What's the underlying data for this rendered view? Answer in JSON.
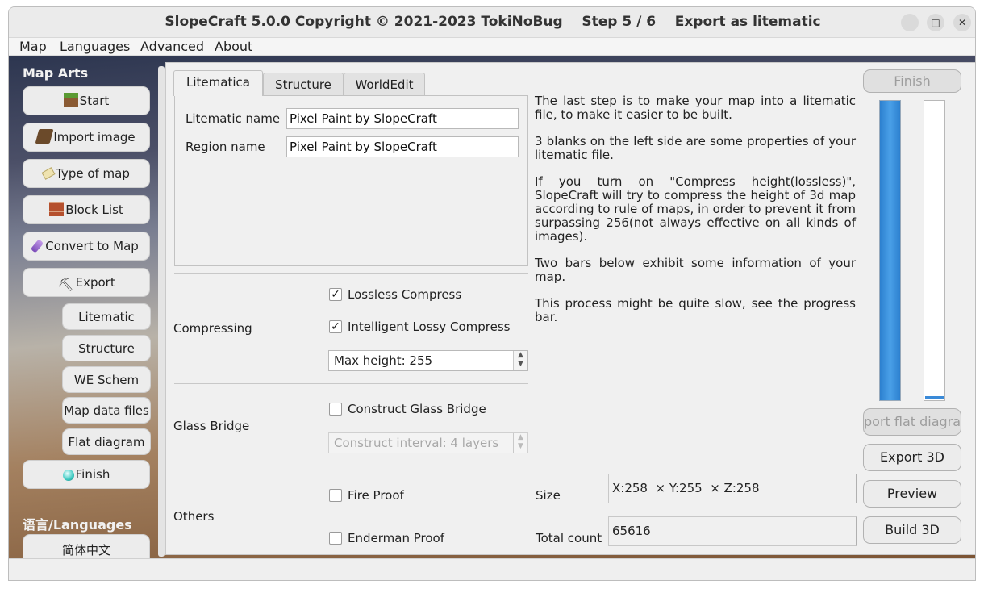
{
  "window": {
    "title": "SlopeCraft 5.0.0 Copyright © 2021-2023 TokiNoBug    Step 5 / 6    Export as litematic",
    "minimize": "–",
    "maximize": "□",
    "close": "✕"
  },
  "menubar": [
    "Map",
    "Languages",
    "Advanced",
    "About"
  ],
  "sidebar": {
    "title": "Map Arts",
    "items": [
      {
        "label": "Start",
        "icon": "grass-block-icon"
      },
      {
        "label": "Import image",
        "icon": "book-icon"
      },
      {
        "label": "Type of map",
        "icon": "map-paper-icon"
      },
      {
        "label": "Block List",
        "icon": "brick-icon"
      },
      {
        "label": "Convert to Map",
        "icon": "crystal-icon"
      },
      {
        "label": "Export",
        "icon": "pickaxe-icon"
      }
    ],
    "subitems": [
      "Litematic",
      "Structure",
      "WE Schem",
      "Map data files",
      "Flat diagram"
    ],
    "finish": {
      "label": "Finish",
      "icon": "diamond-icon"
    },
    "languages_title": "语言/Languages",
    "language_item": "简体中文"
  },
  "tabs": [
    "Litematica",
    "Structure",
    "WorldEdit"
  ],
  "active_tab": 0,
  "form": {
    "litematic_name_label": "Litematic name",
    "litematic_name_value": "Pixel Paint by SlopeCraft",
    "region_name_label": "Region name",
    "region_name_value": "Pixel Paint by SlopeCraft"
  },
  "compressing": {
    "label": "Compressing",
    "lossless": {
      "label": "Lossless Compress",
      "checked": true
    },
    "lossy": {
      "label": "Intelligent Lossy Compress",
      "checked": true
    },
    "max_height": "Max height: 255"
  },
  "glass_bridge": {
    "label": "Glass Bridge",
    "construct": {
      "label": "Construct Glass Bridge",
      "checked": false
    },
    "interval": "Construct interval: 4 layers"
  },
  "others": {
    "label": "Others",
    "fire_proof": {
      "label": "Fire Proof",
      "checked": false
    },
    "enderman_proof": {
      "label": "Enderman Proof",
      "checked": false
    },
    "size_label": "Size",
    "size_value": "X:258  × Y:255  × Z:258",
    "total_label": "Total count",
    "total_value": "65616"
  },
  "description": [
    "The last step is to make your map into a litematic file, to make it easier to be built.",
    "3 blanks on the left side are some properties of your litematic file.",
    "If you turn on \"Compress height(lossless)\", SlopeCraft will try to compress the height of 3d map according to rule of maps, in order to prevent it from surpassing 256(not always effective on all kinds of images).",
    "Two bars below exhibit some information of your map.",
    "This process might be quite slow, see the progress bar."
  ],
  "buttons": {
    "finish": "Finish",
    "export_flat": "port flat diagra",
    "export_3d": "Export 3D",
    "preview": "Preview",
    "build_3d": "Build 3D"
  },
  "progress": {
    "bar1": 1.0,
    "bar2": 0.01
  },
  "colors": {
    "progress": "#2c80cf",
    "accent_check": "#111111"
  }
}
